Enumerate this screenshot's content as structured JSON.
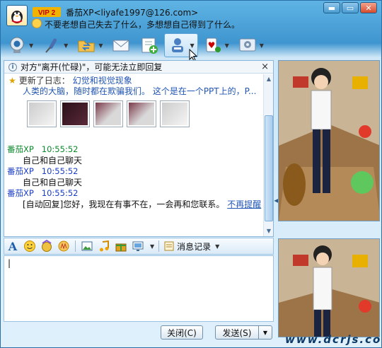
{
  "title": {
    "vip": "VIP 2",
    "name": "番茄XP<liyafe1997@126.com>",
    "signature": "不要老想自己失去了什么，多想想自己得到了什么。",
    "window_buttons": [
      "▬",
      "▭",
      "✕"
    ]
  },
  "toolbar": {
    "items": [
      "webcam-icon",
      "microphone-icon",
      "folder-icon",
      "email-icon",
      "add-contact-icon",
      "user-settings-icon",
      "games-icon",
      "settings-icon"
    ]
  },
  "notice": {
    "text": "对方\"离开(忙碌)\"，可能无法立即回复",
    "close": "×"
  },
  "update": {
    "label": "更新了日志：",
    "title": "幻觉和视觉现象",
    "summary": "人类的大脑，随时都在欺骗我们。 这个是在一个PPT上的，P..."
  },
  "messages": [
    {
      "sender": "番茄XP",
      "time": "10:55:52",
      "color": "#0a8a2c",
      "body": "自己和自己聊天",
      "extra": ""
    },
    {
      "sender": "番茄XP",
      "time": "10:55:52",
      "color": "#1a3ec8",
      "body": "自己和自己聊天",
      "extra": ""
    },
    {
      "sender": "番茄XP",
      "time": "10:55:52",
      "color": "#1a3ec8",
      "body": "[自动回复]您好，我现在有事不在，一会再和您联系。",
      "extra": "不再提醒"
    }
  ],
  "input_toolbar": {
    "history": "消息记录"
  },
  "buttons": {
    "close": "关闭(C)",
    "send": "发送(S)"
  },
  "watermark": "www.dcrjs.com"
}
